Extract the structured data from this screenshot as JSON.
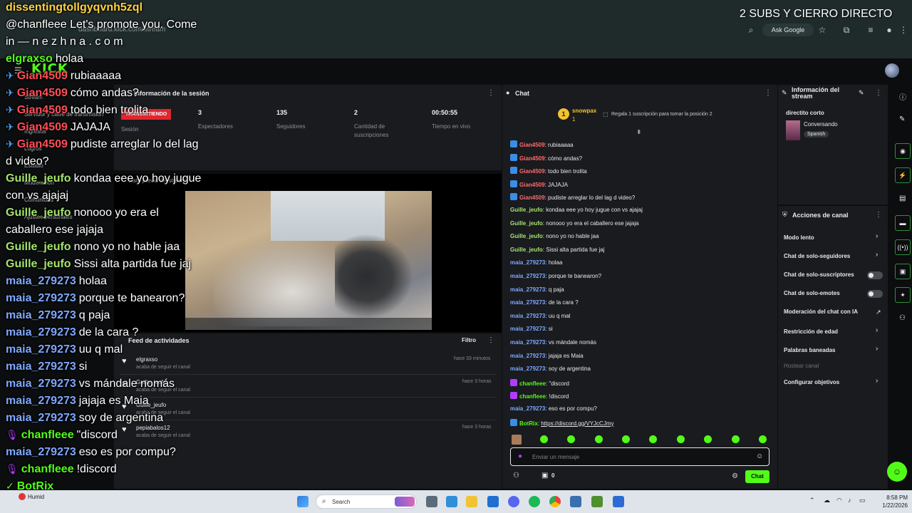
{
  "browser": {
    "url": "dashboard.kick.com/stream",
    "ask_google": "Ask Google"
  },
  "kick": {
    "logo": "KICK"
  },
  "sidebar": {
    "items": [
      "Stream",
      "Servidor y clave de transmisión",
      "Ingresos",
      "Logros",
      "Estudio",
      "Moderación",
      "Comunidad",
      "Ajustes personales"
    ]
  },
  "session": {
    "title": "Información de la sesión",
    "badge": "TRANSMITIENDO",
    "section_label": "Sesión",
    "stats": [
      {
        "value": "3",
        "label": "Espectadores"
      },
      {
        "value": "135",
        "label": "Seguidores"
      },
      {
        "value": "2",
        "label": "Cantidad de suscripciones"
      },
      {
        "value": "00:50:55",
        "label": "Tiempo en vivo"
      }
    ]
  },
  "video": {
    "label": "Vista previa del stream"
  },
  "feed": {
    "title": "Feed de actividades",
    "filter": "Filtro",
    "items": [
      {
        "user": "elgraxso",
        "desc": "acaba de seguir el canal",
        "time": "hace 33 minutos"
      },
      {
        "user": "Guille_jeufo",
        "desc": "acaba de seguir el canal",
        "time": "hace 3 horas"
      },
      {
        "user": "Guille_jeufo",
        "desc": "acaba de seguir el canal",
        "time": ""
      },
      {
        "user": "pepiabalos12",
        "desc": "acaba de seguir el canal",
        "time": "hace 3 horas"
      }
    ]
  },
  "chat": {
    "title": "Chat",
    "top_gifter": "snowpax",
    "top_gifter_rank": "1",
    "top_gifter_count": "1",
    "gift_prompt": "Regala 1 suscripción para tomar la posición 2",
    "placeholder": "Enviar un mensaje",
    "points": "0",
    "send": "Chat",
    "messages": [
      {
        "user": "Gian4509",
        "text": "rubiaaaaa",
        "color": "#ff6b6b",
        "badge": "#3a8ee6"
      },
      {
        "user": "Gian4509",
        "text": "cómo andas?",
        "color": "#ff6b6b",
        "badge": "#3a8ee6"
      },
      {
        "user": "Gian4509",
        "text": "todo bien trolita",
        "color": "#ff6b6b",
        "badge": "#3a8ee6"
      },
      {
        "user": "Gian4509",
        "text": "JAJAJA",
        "color": "#ff6b6b",
        "badge": "#3a8ee6"
      },
      {
        "user": "Gian4509",
        "text": "pudiste arreglar lo del lag d video?",
        "color": "#ff6b6b",
        "badge": "#3a8ee6"
      },
      {
        "user": "Guille_jeufo",
        "text": "kondaa eee yo hoy jugue con vs ajajaj",
        "color": "#a4e36b",
        "badge": ""
      },
      {
        "user": "Guille_jeufo",
        "text": "nonooo yo era el caballero ese jajaja",
        "color": "#a4e36b",
        "badge": ""
      },
      {
        "user": "Guille_jeufo",
        "text": "nono yo no hable jaa",
        "color": "#a4e36b",
        "badge": ""
      },
      {
        "user": "Guille_jeufo",
        "text": "Sissi alta partida fue jaj",
        "color": "#a4e36b",
        "badge": ""
      },
      {
        "user": "maia_279273",
        "text": "holaa",
        "color": "#7fa8ff",
        "badge": ""
      },
      {
        "user": "maia_279273",
        "text": "porque te banearon?",
        "color": "#7fa8ff",
        "badge": ""
      },
      {
        "user": "maia_279273",
        "text": "q paja",
        "color": "#7fa8ff",
        "badge": ""
      },
      {
        "user": "maia_279273",
        "text": "de la cara ?",
        "color": "#7fa8ff",
        "badge": ""
      },
      {
        "user": "maia_279273",
        "text": "uu q mal",
        "color": "#7fa8ff",
        "badge": ""
      },
      {
        "user": "maia_279273",
        "text": "si",
        "color": "#7fa8ff",
        "badge": ""
      },
      {
        "user": "maia_279273",
        "text": "vs mándale nomás",
        "color": "#7fa8ff",
        "badge": ""
      },
      {
        "user": "maia_279273",
        "text": "jajaja es Maia",
        "color": "#7fa8ff",
        "badge": ""
      },
      {
        "user": "maia_279273",
        "text": "soy de argentina",
        "color": "#7fa8ff",
        "badge": ""
      },
      {
        "user": "chanfleee",
        "text": "\"discord",
        "color": "#53fc18",
        "badge": "#b13cff"
      },
      {
        "user": "chanfleee",
        "text": "!discord",
        "color": "#53fc18",
        "badge": "#b13cff"
      },
      {
        "user": "maia_279273",
        "text": "eso es por compu?",
        "color": "#7fa8ff",
        "badge": ""
      },
      {
        "user": "BotRix",
        "text": "https://discord.gg/VYJcCJmy",
        "color": "#53fc18",
        "badge": "#3a8ee6"
      }
    ]
  },
  "stream_info": {
    "title": "Información del stream",
    "stream_title": "directito corto",
    "category": "Conversando",
    "language": "Spanish"
  },
  "actions": {
    "title": "Acciones de canal",
    "items": [
      {
        "label": "Modo lento",
        "control": "chevron"
      },
      {
        "label": "Chat de solo-seguidores",
        "control": "chevron"
      },
      {
        "label": "Chat de solo-suscriptores",
        "control": "toggle"
      },
      {
        "label": "Chat de solo-emotes",
        "control": "toggle"
      },
      {
        "label": "Moderación del chat con IA",
        "control": "link"
      },
      {
        "label": "Restricción de edad",
        "control": "chevron"
      },
      {
        "label": "Palabras baneadas",
        "control": "chevron"
      },
      {
        "label": "Hostear canal",
        "control": "disabled"
      },
      {
        "label": "Configurar objetivos",
        "control": "chevron"
      }
    ]
  },
  "overlay": {
    "top_right": "2 SUBS Y CIERRO DIRECTO",
    "lines": [
      {
        "user": "dissentingtollgyqvnh5zql",
        "text": "",
        "color": "#ffd23f",
        "icon": ""
      },
      {
        "user": "",
        "text": "@chanfleee Let's promote you. Come",
        "color": "#ffffff",
        "icon": ""
      },
      {
        "user": "",
        "text": "in — n e z h n a . c o m",
        "color": "#ffffff",
        "icon": ""
      },
      {
        "user": "elgraxso",
        "text": "holaa",
        "color": "#53fc18",
        "icon": ""
      },
      {
        "user": "Gian4509",
        "text": "rubiaaaaa",
        "color": "#ff4d57",
        "icon": "sword"
      },
      {
        "user": "Gian4509",
        "text": "cómo andas?",
        "color": "#ff4d57",
        "icon": "sword"
      },
      {
        "user": "Gian4509",
        "text": "todo bien trolita",
        "color": "#ff4d57",
        "icon": "sword"
      },
      {
        "user": "Gian4509",
        "text": "JAJAJA",
        "color": "#ff4d57",
        "icon": "sword"
      },
      {
        "user": "Gian4509",
        "text": "pudiste arreglar lo del lag",
        "color": "#ff4d57",
        "icon": "sword"
      },
      {
        "user": "",
        "text": "d video?",
        "color": "#ffffff",
        "icon": ""
      },
      {
        "user": "Guille_jeufo",
        "text": "kondaa eee yo hoy jugue",
        "color": "#a4e36b",
        "icon": ""
      },
      {
        "user": "",
        "text": "con vs ajajaj",
        "color": "#ffffff",
        "icon": ""
      },
      {
        "user": "Guille_jeufo",
        "text": "nonooo yo era el",
        "color": "#a4e36b",
        "icon": ""
      },
      {
        "user": "",
        "text": "caballero ese jajaja",
        "color": "#ffffff",
        "icon": ""
      },
      {
        "user": "Guille_jeufo",
        "text": "nono yo no hable jaa",
        "color": "#a4e36b",
        "icon": ""
      },
      {
        "user": "Guille_jeufo",
        "text": "Sissi alta partida fue jaj",
        "color": "#a4e36b",
        "icon": ""
      },
      {
        "user": "maia_279273",
        "text": "holaa",
        "color": "#7fa8ff",
        "icon": ""
      },
      {
        "user": "maia_279273",
        "text": "porque te banearon?",
        "color": "#7fa8ff",
        "icon": ""
      },
      {
        "user": "maia_279273",
        "text": "q paja",
        "color": "#7fa8ff",
        "icon": ""
      },
      {
        "user": "maia_279273",
        "text": "de la cara ?",
        "color": "#7fa8ff",
        "icon": ""
      },
      {
        "user": "maia_279273",
        "text": "uu q mal",
        "color": "#7fa8ff",
        "icon": ""
      },
      {
        "user": "maia_279273",
        "text": "si",
        "color": "#7fa8ff",
        "icon": ""
      },
      {
        "user": "maia_279273",
        "text": "vs mándale nomás",
        "color": "#7fa8ff",
        "icon": ""
      },
      {
        "user": "maia_279273",
        "text": "jajaja es Maia",
        "color": "#7fa8ff",
        "icon": ""
      },
      {
        "user": "maia_279273",
        "text": "soy de argentina",
        "color": "#7fa8ff",
        "icon": ""
      },
      {
        "user": "chanfleee",
        "text": "\"discord",
        "color": "#53fc18",
        "icon": "mic"
      },
      {
        "user": "maia_279273",
        "text": "eso es por compu?",
        "color": "#7fa8ff",
        "icon": ""
      },
      {
        "user": "chanfleee",
        "text": "!discord",
        "color": "#53fc18",
        "icon": "mic"
      },
      {
        "user": "BotRix",
        "text": "",
        "color": "#53fc18",
        "icon": "bot"
      },
      {
        "user": "",
        "text": "https://discord.gg/VYJcCJmy",
        "color": "#ffffff",
        "icon": ""
      }
    ]
  },
  "taskbar": {
    "weather": "Humid",
    "search": "Search",
    "time": "8:58 PM",
    "date": "1/22/2026"
  },
  "colors": {
    "accent": "#53fc18",
    "live": "#e0262f",
    "panel": "#191b1f",
    "background": "#0b0d0e"
  }
}
